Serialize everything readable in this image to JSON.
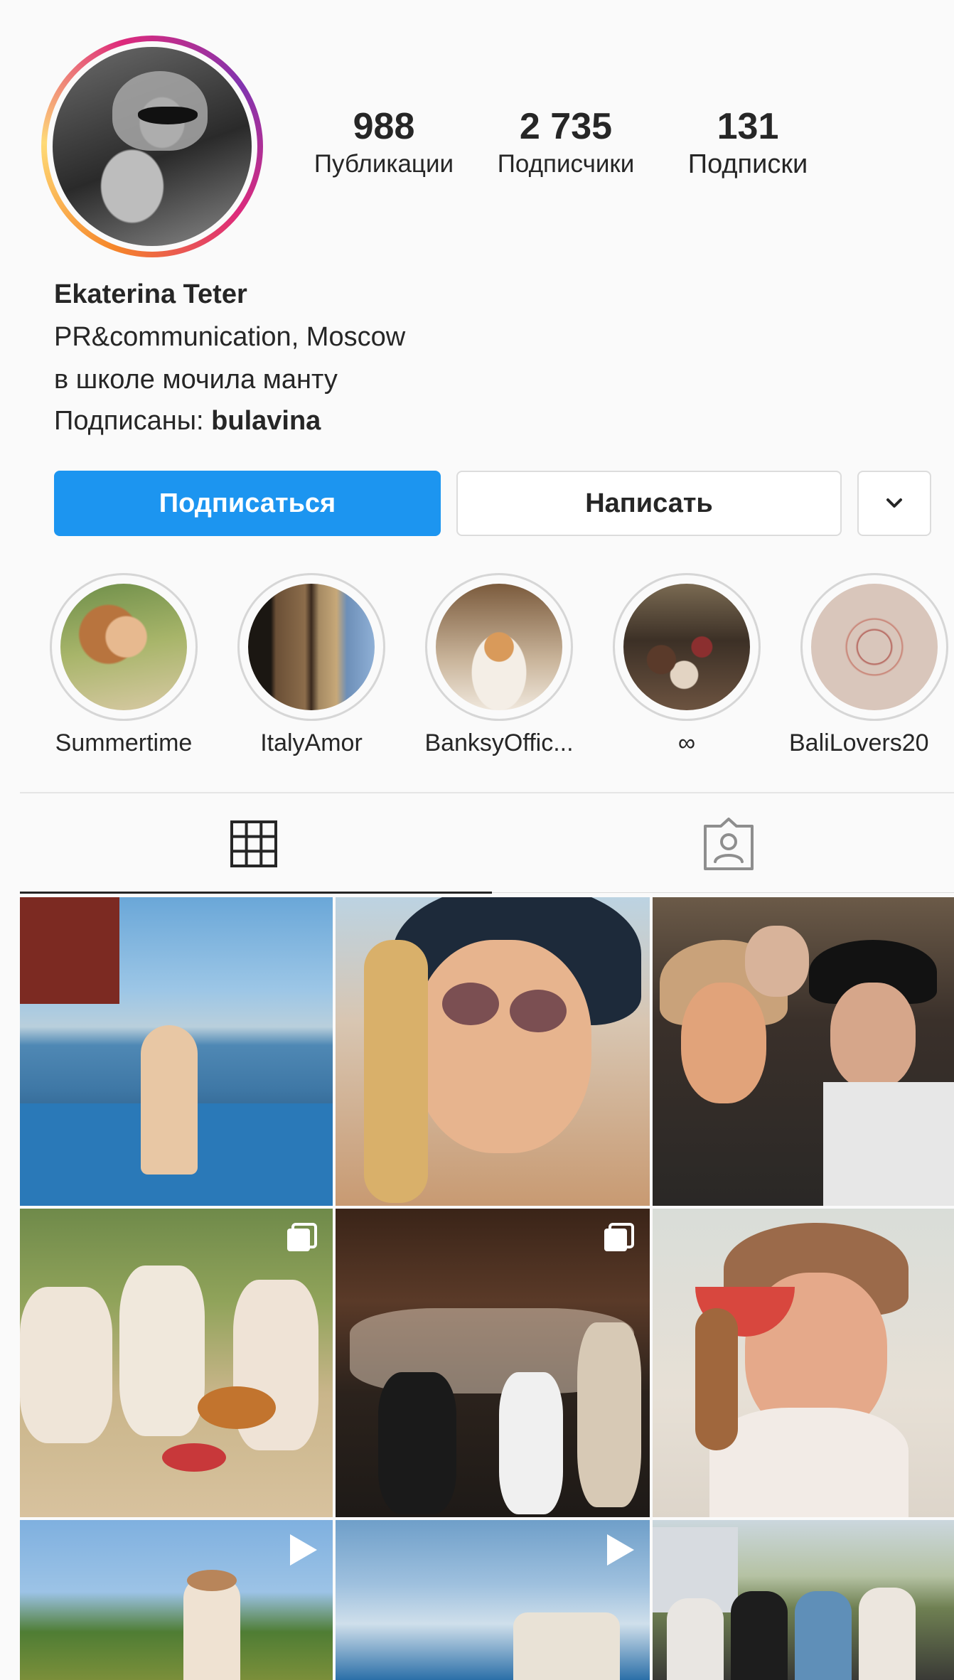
{
  "profile": {
    "name": "Ekaterina Teter",
    "bio_line1": "PR&communication, Moscow",
    "bio_line2": "в школе мочила манту",
    "followed_by_prefix": "Подписаны: ",
    "followed_by_user": "bulavina"
  },
  "stats": {
    "posts": {
      "value": "988",
      "label": "Публикации"
    },
    "followers": {
      "value": "2 735",
      "label": "Подписчики"
    },
    "following": {
      "value": "131",
      "label": "Подписки"
    }
  },
  "actions": {
    "follow_label": "Подписаться",
    "message_label": "Написать",
    "more_icon": "chevron-down-icon"
  },
  "highlights": [
    {
      "label": "Summertime"
    },
    {
      "label": "ItalyAmor"
    },
    {
      "label": "BanksyOffic..."
    },
    {
      "label": "∞"
    },
    {
      "label": "BaliLovers20"
    }
  ],
  "tabs": [
    {
      "icon": "grid-icon",
      "active": true
    },
    {
      "icon": "tagged-person-icon",
      "active": false
    }
  ],
  "grid_badges": {
    "carousel_icon": "carousel-icon",
    "reel_icon": "play-icon"
  },
  "colors": {
    "accent": "#1c95f0",
    "text": "#262626",
    "background": "#fafafa"
  }
}
